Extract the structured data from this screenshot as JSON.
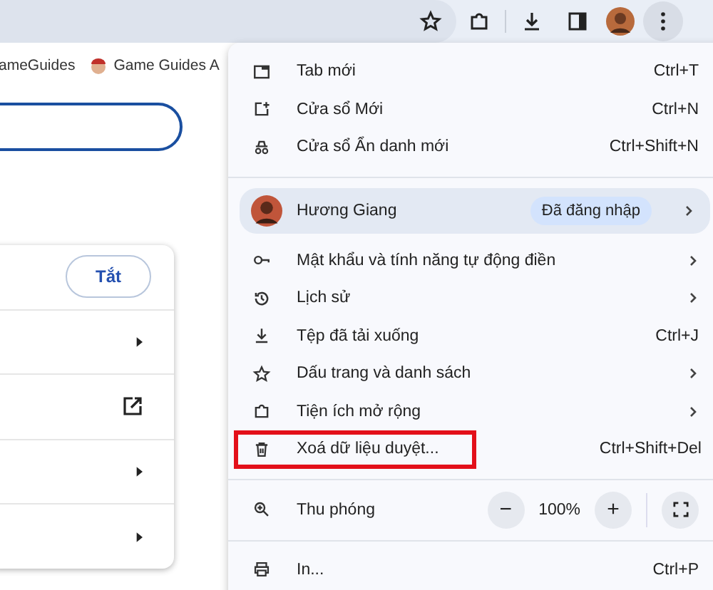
{
  "bookmarks": [
    {
      "label": "ameGuides",
      "has_icon": false
    },
    {
      "label": "Game Guides A",
      "has_icon": true
    }
  ],
  "settings_card": {
    "button": "Tắt",
    "rows": [
      {
        "kind": "arrow"
      },
      {
        "kind": "external"
      },
      {
        "kind": "arrow"
      },
      {
        "kind": "arrow"
      }
    ]
  },
  "menu": {
    "sections": [
      [
        {
          "kind": "item",
          "label": "Tab mới",
          "shortcut": "Ctrl+T",
          "submenu": false,
          "highlighted": false
        },
        {
          "kind": "item",
          "label": "Cửa sổ Mới",
          "shortcut": "Ctrl+N",
          "submenu": false,
          "highlighted": false
        },
        {
          "kind": "item",
          "label": "Cửa sổ Ẩn danh mới",
          "shortcut": "Ctrl+Shift+N",
          "submenu": false,
          "highlighted": false
        }
      ],
      [
        {
          "kind": "profile",
          "label": "Hương Giang",
          "badge": "Đã đăng nhập",
          "submenu": true
        },
        {
          "kind": "item",
          "label": "Mật khẩu và tính năng tự động điền",
          "submenu": true,
          "highlighted": false
        },
        {
          "kind": "item",
          "label": "Lịch sử",
          "submenu": true,
          "highlighted": false
        },
        {
          "kind": "item",
          "label": "Tệp đã tải xuống",
          "shortcut": "Ctrl+J",
          "submenu": false,
          "highlighted": false
        },
        {
          "kind": "item",
          "label": "Dấu trang và danh sách",
          "submenu": true,
          "highlighted": false
        },
        {
          "kind": "item",
          "label": "Tiện ích mở rộng",
          "submenu": true,
          "highlighted": false
        },
        {
          "kind": "item",
          "label": "Xoá dữ liệu duyệt...",
          "shortcut": "Ctrl+Shift+Del",
          "submenu": false,
          "highlighted": true
        }
      ],
      [
        {
          "kind": "zoom",
          "label": "Thu phóng",
          "minus": "−",
          "value": "100%",
          "plus": "+"
        }
      ],
      [
        {
          "kind": "item",
          "label": "In...",
          "shortcut": "Ctrl+P",
          "submenu": false,
          "highlighted": false
        }
      ]
    ]
  }
}
